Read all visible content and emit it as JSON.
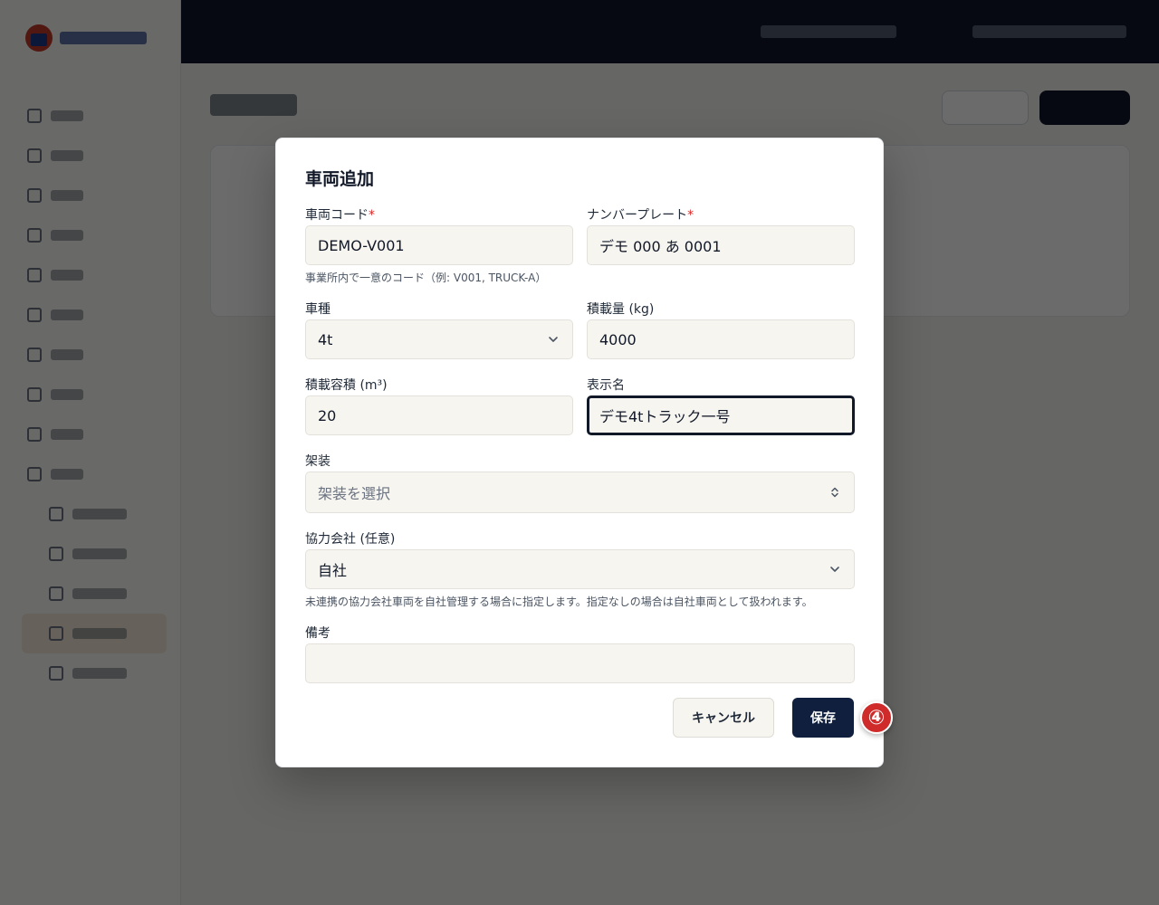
{
  "modal": {
    "title": "車両追加",
    "vehicle_code": {
      "label": "車両コード",
      "required_mark": "*",
      "value": "DEMO-V001",
      "help": "事業所内で一意のコード（例: V001, TRUCK-A）"
    },
    "license_plate": {
      "label": "ナンバープレート",
      "required_mark": "*",
      "value": "デモ 000 あ 0001"
    },
    "vehicle_type": {
      "label": "車種",
      "value": "4t"
    },
    "load_capacity": {
      "label": "積載量 (kg)",
      "value": "4000"
    },
    "load_volume": {
      "label": "積載容積 (m³)",
      "value": "20"
    },
    "display_name": {
      "label": "表示名",
      "value": "デモ4tトラック一号"
    },
    "body_type": {
      "label": "架装",
      "placeholder": "架装を選択"
    },
    "partner": {
      "label": "協力会社 (任意)",
      "value": "自社",
      "help": "未連携の協力会社車両を自社管理する場合に指定します。指定なしの場合は自社車両として扱われます。"
    },
    "notes": {
      "label": "備考",
      "value": ""
    },
    "cancel_label": "キャンセル",
    "save_label": "保存"
  },
  "step_badge": "④",
  "colors": {
    "primary": "#0f1f3d",
    "required": "#dc2626",
    "badge": "#cf2b2b",
    "field_bg": "#f6f5f0"
  }
}
